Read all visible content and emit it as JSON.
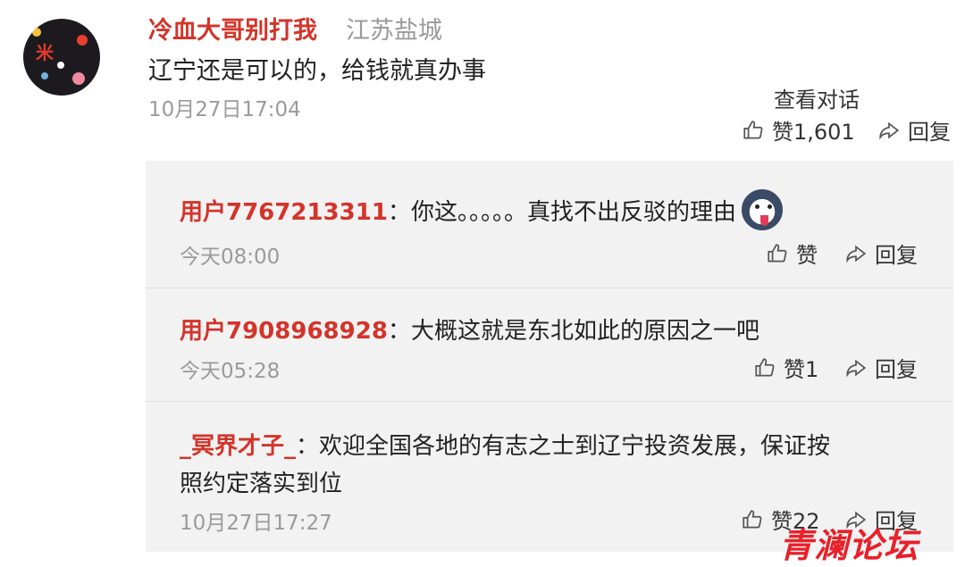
{
  "main_comment": {
    "username": "冷血大哥别打我",
    "location": "江苏盐城",
    "text": "辽宁还是可以的，给钱就真办事",
    "time": "10月27日17:04",
    "view_conversation": "查看对话",
    "like_label": "赞1,601",
    "reply_label": "回复",
    "avatar_text": "米"
  },
  "replies": [
    {
      "username": "用户7767213311",
      "colon": "：",
      "text": "你这。。。。。真找不出反驳的理由",
      "time": "今天08:00",
      "like_label": "赞",
      "reply_label": "回复"
    },
    {
      "username": "用户7908968928",
      "colon": "：",
      "text": "大概这就是东北如此的原因之一吧",
      "time": "今天05:28",
      "like_label": "赞1",
      "reply_label": "回复"
    },
    {
      "username": "_冥界才子_",
      "colon": "：",
      "text_line1": "欢迎全国各地的有志之士到辽宁投资发展，保证按",
      "text_line2": "照约定落实到位",
      "time": "10月27日17:27",
      "like_label": "赞22",
      "reply_label": "回复"
    }
  ],
  "watermark": "青澜论坛",
  "colors": {
    "username": "#d3342a",
    "meta": "#9a9a9a",
    "reply_bg": "#f2f2f2"
  }
}
